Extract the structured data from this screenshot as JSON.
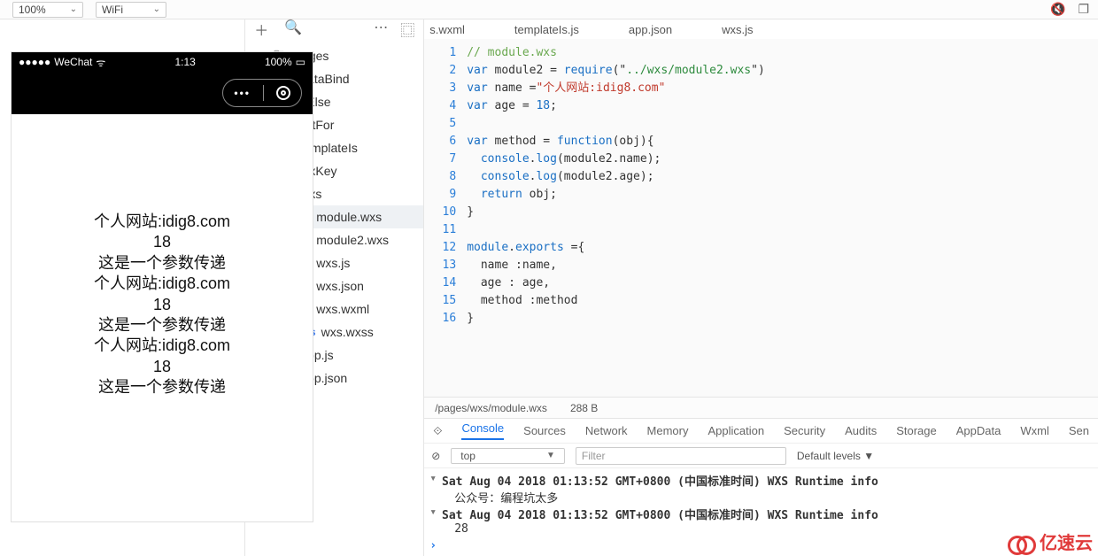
{
  "top": {
    "zoom": "100%",
    "network": "WiFi",
    "tabs": [
      "s.wxml",
      "templateIs.js",
      "app.json",
      "wxs.js"
    ]
  },
  "phone": {
    "carrier": "WeChat",
    "time": "1:13",
    "battery": "100%",
    "lines": [
      "个人网站:idig8.com",
      "18",
      "这是一个参数传递",
      "个人网站:idig8.com",
      "18",
      "这是一个参数传递",
      "个人网站:idig8.com",
      "18",
      "这是一个参数传递"
    ]
  },
  "tree": {
    "root": "pages",
    "folders": [
      "dataBind",
      "ifElse",
      "listFor",
      "templateIs",
      "wxKey"
    ],
    "openFolder": "wxs",
    "wxsFiles": [
      {
        "name": "module.wxs",
        "type": "wxs",
        "sel": true
      },
      {
        "name": "module2.wxs",
        "type": "wxs",
        "sel": false
      },
      {
        "name": "wxs.js",
        "type": "js",
        "sel": false
      },
      {
        "name": "wxs.json",
        "type": "json",
        "sel": false
      },
      {
        "name": "wxs.wxml",
        "type": "wxml",
        "sel": false
      },
      {
        "name": "wxs.wxss",
        "type": "wxss",
        "sel": false
      }
    ],
    "rootFiles": [
      {
        "name": "app.js",
        "type": "js"
      },
      {
        "name": "app.json",
        "type": "json"
      }
    ]
  },
  "code": {
    "lines": [
      {
        "t": "cm",
        "s": "// module.wxs"
      },
      {
        "t": "raw",
        "s": "var module2 = require(\"../wxs/module2.wxs\")"
      },
      {
        "t": "raw",
        "s": "var name =\"个人网站:idig8.com\""
      },
      {
        "t": "raw",
        "s": "var age = 18;"
      },
      {
        "t": "raw",
        "s": ""
      },
      {
        "t": "raw",
        "s": "var method = function(obj){"
      },
      {
        "t": "raw",
        "s": "  console.log(module2.name);"
      },
      {
        "t": "raw",
        "s": "  console.log(module2.age);"
      },
      {
        "t": "raw",
        "s": "  return obj;"
      },
      {
        "t": "raw",
        "s": "}"
      },
      {
        "t": "raw",
        "s": ""
      },
      {
        "t": "raw",
        "s": "module.exports ={"
      },
      {
        "t": "raw",
        "s": "  name :name,"
      },
      {
        "t": "raw",
        "s": "  age : age,"
      },
      {
        "t": "raw",
        "s": "  method :method"
      },
      {
        "t": "raw",
        "s": "}"
      }
    ]
  },
  "status": {
    "path": "/pages/wxs/module.wxs",
    "size": "288 B"
  },
  "devtabs": [
    "Console",
    "Sources",
    "Network",
    "Memory",
    "Application",
    "Security",
    "Audits",
    "Storage",
    "AppData",
    "Wxml",
    "Sen"
  ],
  "console": {
    "context": "top",
    "filterPh": "Filter",
    "levels": "Default levels ▼",
    "entries": [
      {
        "h": "Sat Aug 04 2018 01:13:52 GMT+0800 (中国标准时间) WXS Runtime info",
        "b": "公众号：编程坑太多"
      },
      {
        "h": "Sat Aug 04 2018 01:13:52 GMT+0800 (中国标准时间) WXS Runtime info",
        "b": "28"
      }
    ]
  },
  "watermark": "亿速云"
}
